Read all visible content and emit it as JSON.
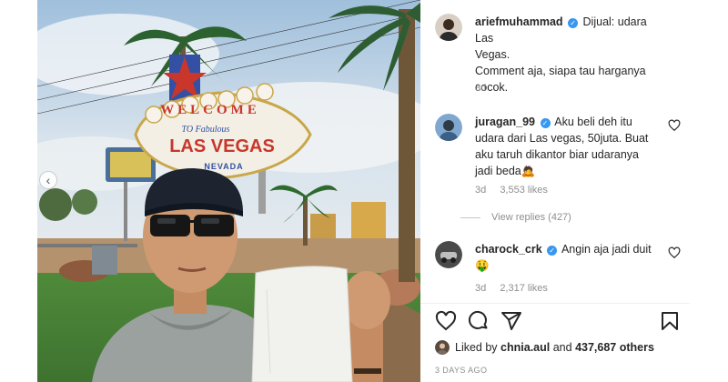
{
  "photo": {
    "sign": {
      "welcome": "WELCOME",
      "to_fabulous": "TO Fabulous",
      "city": "LAS VEGAS",
      "state": "NEVADA"
    }
  },
  "post": {
    "author": "ariefmuhammad",
    "caption_lines": [
      "Dijual: udara Las",
      "Vegas.",
      "Comment aja, siapa tau harganya",
      "cocok."
    ],
    "age": "3d"
  },
  "comments": [
    {
      "username": "juragan_99",
      "text_lines": [
        "Aku beli deh itu",
        "udara dari Las vegas, 50juta. Buat",
        "aku taruh dikantor biar udaranya",
        "jadi beda"
      ],
      "emoji": "🙇",
      "age": "3d",
      "likes": "3,553 likes"
    },
    {
      "username": "charock_crk",
      "text_lines": [
        "Angin aja jadi duit"
      ],
      "emoji": "🤑",
      "age": "3d",
      "likes": "2,317 likes"
    }
  ],
  "view_replies": "View replies (427)",
  "likes_bar": {
    "prefix": "Liked by",
    "user": "chnia.aul",
    "joiner": "and",
    "count": "437,687 others"
  },
  "timestamp": "3 DAYS AGO",
  "icons": [
    "heart-icon",
    "comment-icon",
    "share-icon",
    "bookmark-icon",
    "verified-icon",
    "chevron-left-icon"
  ],
  "colors": {
    "verified": "#3897f0",
    "muted": "#8e8e8e",
    "text": "#262626"
  }
}
